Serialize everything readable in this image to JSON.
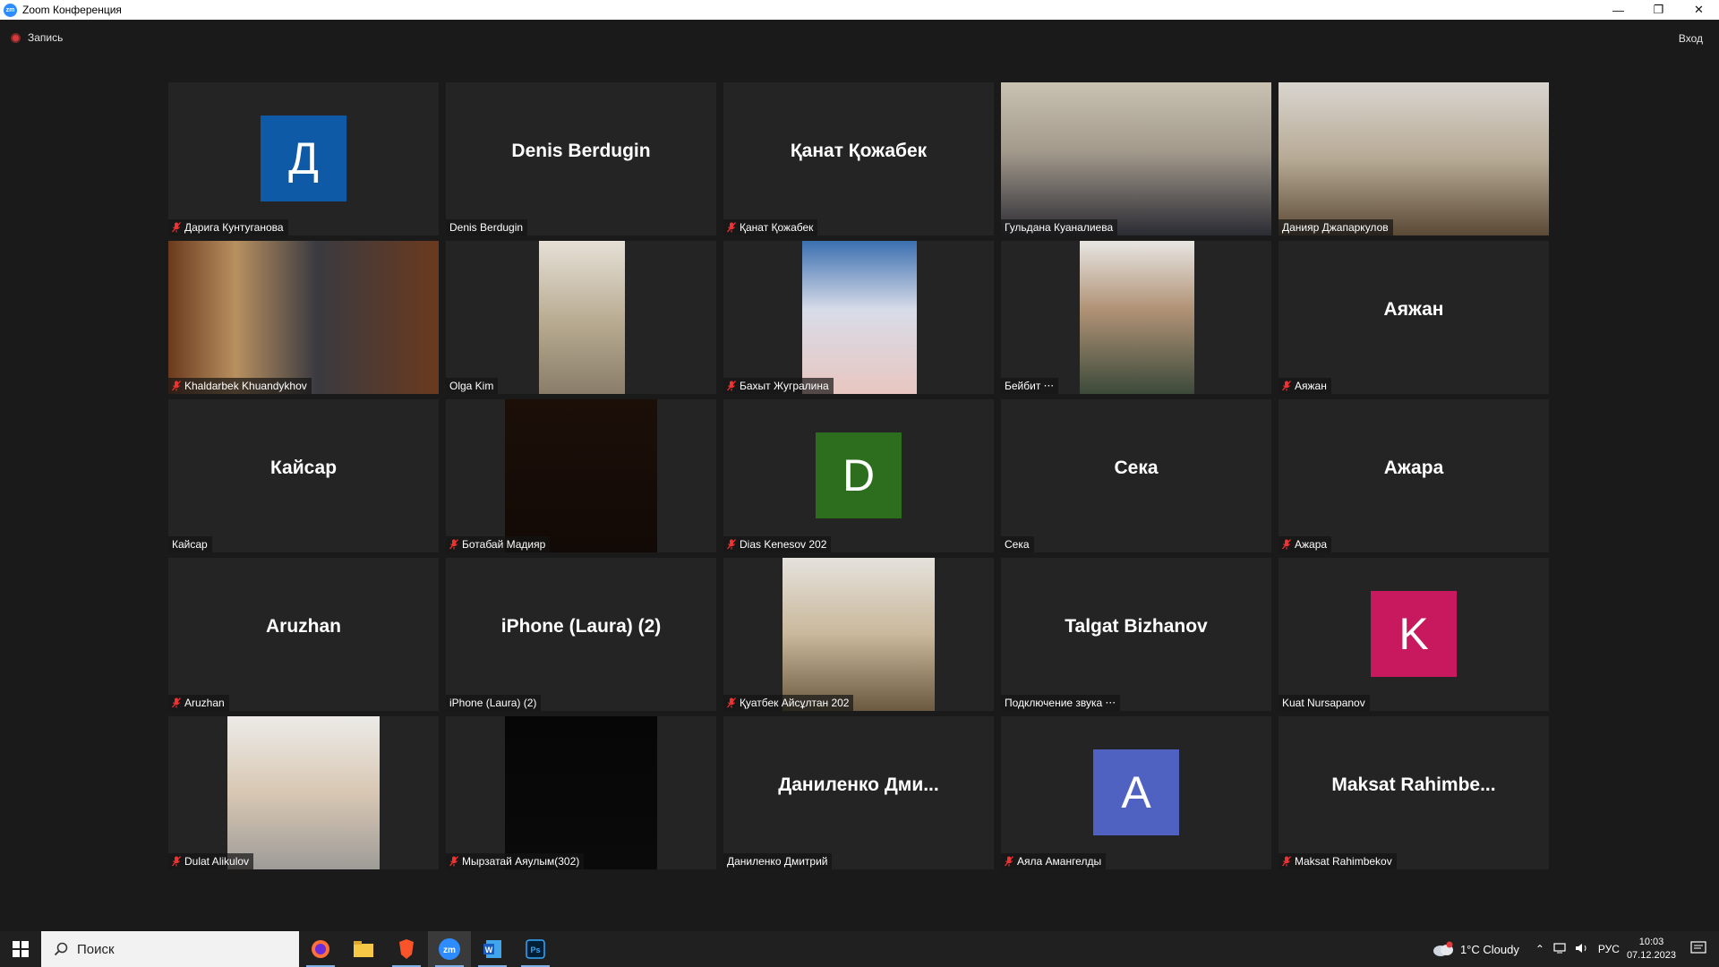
{
  "window": {
    "title": "Zoom Конференция",
    "controls": [
      "minimize",
      "restore",
      "close"
    ]
  },
  "topbar": {
    "recording_label": "Запись",
    "signin_label": "Вход"
  },
  "colors": {
    "tile_bg": "#242424",
    "active_speaker_border": "#c5e04a",
    "avatar_D_cyr": "#0e5aa7",
    "avatar_D_lat": "#2c6e1d",
    "avatar_K": "#c8185e",
    "avatar_A": "#5062c1"
  },
  "participants": [
    {
      "display_name": "Д",
      "nameplate": "Дарига Кунтуганова",
      "muted": true,
      "kind": "avatar",
      "avatar_color": "#0e5aa7"
    },
    {
      "display_name": "Denis Berdugin",
      "nameplate": "Denis Berdugin",
      "muted": false,
      "kind": "name"
    },
    {
      "display_name": "Қанат Қожабек",
      "nameplate": "Қанат Қожабек",
      "muted": true,
      "kind": "name"
    },
    {
      "display_name": "",
      "nameplate": "Гульдана Куаналиева",
      "muted": false,
      "kind": "video",
      "active": true
    },
    {
      "display_name": "",
      "nameplate": "Данияр Джапаркулов",
      "muted": false,
      "kind": "video"
    },
    {
      "display_name": "",
      "nameplate": "Khaldarbek Khuandykhov",
      "muted": true,
      "kind": "video"
    },
    {
      "display_name": "",
      "nameplate": "Olga Kim",
      "muted": false,
      "kind": "video"
    },
    {
      "display_name": "",
      "nameplate": "Бахыт Жугралина",
      "muted": true,
      "kind": "video"
    },
    {
      "display_name": "",
      "nameplate": "Бейбит ⋅⋅⋅",
      "muted": false,
      "kind": "video"
    },
    {
      "display_name": "Аяжан",
      "nameplate": "Аяжан",
      "muted": true,
      "kind": "name"
    },
    {
      "display_name": "Кайсар",
      "nameplate": "Кайсар",
      "muted": false,
      "kind": "name"
    },
    {
      "display_name": "",
      "nameplate": "Ботабай Мадияр",
      "muted": true,
      "kind": "video"
    },
    {
      "display_name": "D",
      "nameplate": "Dias Kenesov 202",
      "muted": true,
      "kind": "avatar",
      "avatar_color": "#2c6e1d"
    },
    {
      "display_name": "Сека",
      "nameplate": "Сека",
      "muted": false,
      "kind": "name"
    },
    {
      "display_name": "Ажара",
      "nameplate": "Ажара",
      "muted": true,
      "kind": "name"
    },
    {
      "display_name": "Aruzhan",
      "nameplate": "Aruzhan",
      "muted": true,
      "kind": "name"
    },
    {
      "display_name": "iPhone (Laura) (2)",
      "nameplate": "iPhone (Laura) (2)",
      "muted": false,
      "kind": "name"
    },
    {
      "display_name": "",
      "nameplate": "Қуатбек Айсұлтан 202",
      "muted": true,
      "kind": "video"
    },
    {
      "display_name": "Talgat Bizhanov",
      "nameplate": "Подключение звука ⋅⋅⋅",
      "muted": false,
      "kind": "name"
    },
    {
      "display_name": "K",
      "nameplate": "Kuat Nursapanov",
      "muted": false,
      "kind": "avatar",
      "avatar_color": "#c8185e"
    },
    {
      "display_name": "",
      "nameplate": "Dulat Alikulov",
      "muted": true,
      "kind": "video"
    },
    {
      "display_name": "",
      "nameplate": "Мырзатай Аяулым(302)",
      "muted": true,
      "kind": "video"
    },
    {
      "display_name": "Даниленко Дми...",
      "nameplate": "Даниленко Дмитрий",
      "muted": false,
      "kind": "name"
    },
    {
      "display_name": "A",
      "nameplate": "Аяла Амангелды",
      "muted": true,
      "kind": "avatar",
      "avatar_color": "#5062c1"
    },
    {
      "display_name": "Maksat Rahimbe...",
      "nameplate": "Maksat Rahimbekov",
      "muted": true,
      "kind": "name"
    }
  ],
  "taskbar": {
    "search_placeholder": "Поиск",
    "apps": [
      "firefox-icon",
      "file-explorer-icon",
      "brave-icon",
      "zoom-icon",
      "word-icon",
      "photoshop-icon"
    ],
    "active_app": "zoom-icon",
    "weather": "1°C  Cloudy",
    "language": "РУС",
    "time": "10:03",
    "date": "07.12.2023"
  }
}
